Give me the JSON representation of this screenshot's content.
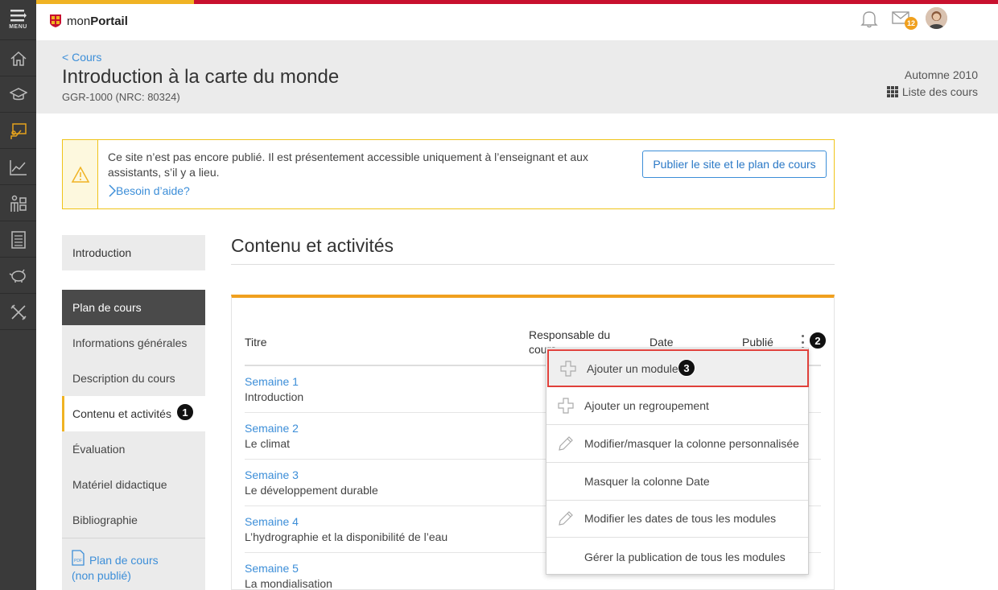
{
  "rail": {
    "menu_label": "MENU",
    "items": [
      "home-icon",
      "graduation-cap-icon",
      "course-board-icon",
      "chart-icon",
      "people-icon",
      "list-icon",
      "piggy-bank-icon",
      "tools-icon"
    ],
    "active_index": 2
  },
  "topbar": {
    "logo_prefix": "mon",
    "logo_bold": "Portail",
    "mail_count": "12"
  },
  "header": {
    "back_link": "Cours",
    "title": "Introduction à la carte du monde",
    "code": "GGR-1000 (NRC: 80324)",
    "term": "Automne 2010",
    "course_list": "Liste des cours"
  },
  "alert": {
    "text": "Ce site n’est pas encore publié. Il est présentement accessible uniquement à l’enseignant et aux assistants, s’il y a lieu.",
    "help": "Besoin d’aide?",
    "button": "Publier le site et le plan de cours"
  },
  "sidebar": {
    "intro": "Introduction",
    "section_head": "Plan de cours",
    "items": [
      "Informations générales",
      "Description du cours",
      "Contenu et activités",
      "Évaluation",
      "Matériel didactique",
      "Bibliographie"
    ],
    "active_index": 2,
    "pdf_link_line1": "Plan de cours",
    "pdf_link_line2": "(non publié)"
  },
  "main": {
    "title": "Contenu et activités",
    "columns": {
      "title": "Titre",
      "responsible_line1": "Responsable du",
      "responsible_line2": "cours",
      "date": "Date",
      "published": "Publié"
    },
    "rows": [
      {
        "week": "Semaine 1",
        "name": "Introduction"
      },
      {
        "week": "Semaine 2",
        "name": "Le climat"
      },
      {
        "week": "Semaine 3",
        "name": "Le développement durable"
      },
      {
        "week": "Semaine 4",
        "name": "L’hydrographie et la disponibilité de l’eau"
      },
      {
        "week": "Semaine 5",
        "name": "La mondialisation"
      }
    ]
  },
  "dropdown": {
    "items": [
      {
        "label": "Ajouter un module",
        "icon": "plus-icon"
      },
      {
        "label": "Ajouter un regroupement",
        "icon": "plus-icon"
      },
      {
        "label": "Modifier/masquer la colonne personnalisée",
        "icon": "pencil-icon"
      },
      {
        "label": "Masquer la colonne Date",
        "icon": ""
      },
      {
        "label": "Modifier les dates de tous les modules",
        "icon": "pencil-icon"
      },
      {
        "label": "Gérer la publication de tous les modules",
        "icon": ""
      }
    ]
  },
  "markers": [
    "1",
    "2",
    "3"
  ],
  "colors": {
    "accent_yellow": "#f0b323",
    "accent_red": "#c8102e",
    "link_blue": "#3c8ed8",
    "highlight_red": "#e0403a"
  }
}
